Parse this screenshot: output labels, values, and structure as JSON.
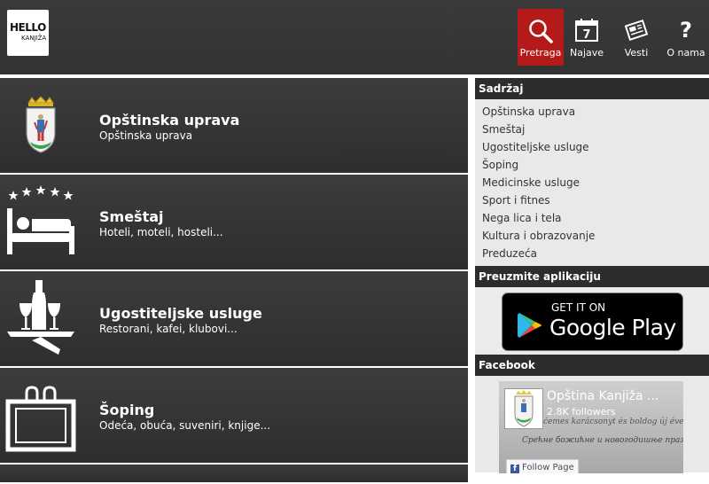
{
  "header": {
    "logo_line1": "HELLO",
    "logo_line2": "KANJIŽA",
    "nav": [
      {
        "label": "Pretraga",
        "icon": "search-icon",
        "active": true
      },
      {
        "label": "Najave",
        "icon": "calendar-icon",
        "calendar_day": "7"
      },
      {
        "label": "Vesti",
        "icon": "newspaper-icon"
      },
      {
        "label": "O nama",
        "icon": "question-icon",
        "icon_glyph": "?"
      }
    ]
  },
  "categories": [
    {
      "title": "Opštinska uprava",
      "subtitle": "Opštinska uprava",
      "icon": "coat-of-arms-icon"
    },
    {
      "title": "Smeštaj",
      "subtitle": "Hoteli, moteli, hosteli...",
      "icon": "bed-stars-icon"
    },
    {
      "title": "Ugostiteljske usluge",
      "subtitle": "Restorani, kafei, klubovi...",
      "icon": "wine-tray-icon"
    },
    {
      "title": "Šoping",
      "subtitle": "Odeća, obuća, suveniri, knjige...",
      "icon": "shopping-bag-icon"
    }
  ],
  "sidebar": {
    "contents_title": "Sadržaj",
    "contents": [
      "Opštinska uprava",
      "Smeštaj",
      "Ugostiteljske usluge",
      "Šoping",
      "Medicinske usluge",
      "Sport i fitnes",
      "Nega lica i tela",
      "Kultura i obrazovanje",
      "Preduzeća"
    ],
    "apps_title": "Preuzmite aplikaciju",
    "google_play": {
      "get": "GET IT ON",
      "name": "Google Play"
    },
    "facebook_title": "Facebook",
    "facebook": {
      "page_name": "Opština Kanjiža ...",
      "followers": "2.8K followers",
      "script_top": "ćemes karácsonyt és boldog új évet!",
      "script_mid": "Срећне божићне и новогодишње празнике!",
      "follow_label": "Follow Page",
      "follow_icon_glyph": "f"
    }
  },
  "colors": {
    "header_bg": "#363636",
    "active_nav": "#b51a1a",
    "tile_bg": "#343434",
    "sidebar_bg": "#e9e9e9",
    "sidebar_head_bg": "#2d2d2d"
  }
}
